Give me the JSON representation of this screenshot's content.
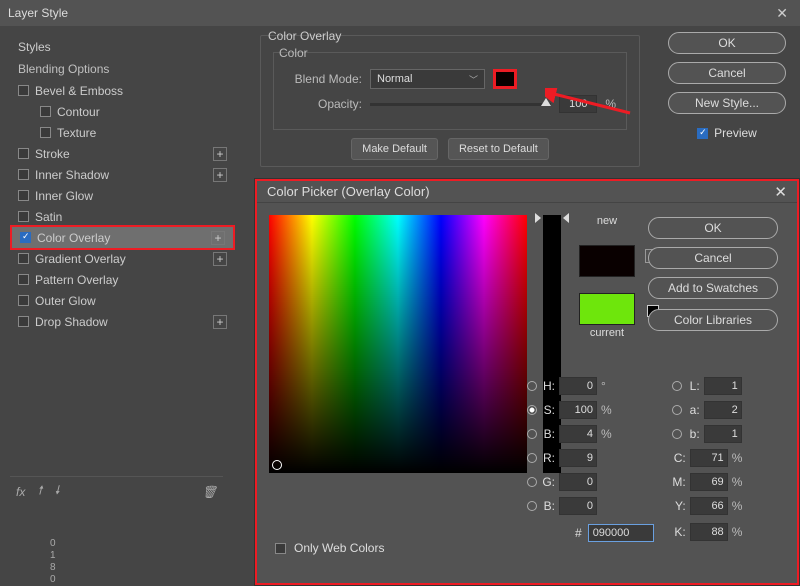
{
  "window": {
    "title": "Layer Style"
  },
  "sidebar": {
    "header": "Styles",
    "blending": "Blending Options",
    "items": [
      {
        "label": "Bevel & Emboss",
        "checked": false,
        "plus": false
      },
      {
        "label": "Contour",
        "checked": false,
        "plus": false,
        "indent": true
      },
      {
        "label": "Texture",
        "checked": false,
        "plus": false,
        "indent": true
      },
      {
        "label": "Stroke",
        "checked": false,
        "plus": true
      },
      {
        "label": "Inner Shadow",
        "checked": false,
        "plus": true
      },
      {
        "label": "Inner Glow",
        "checked": false,
        "plus": false
      },
      {
        "label": "Satin",
        "checked": false,
        "plus": false
      },
      {
        "label": "Color Overlay",
        "checked": true,
        "plus": true,
        "highlighted": true
      },
      {
        "label": "Gradient Overlay",
        "checked": false,
        "plus": true
      },
      {
        "label": "Pattern Overlay",
        "checked": false,
        "plus": false
      },
      {
        "label": "Outer Glow",
        "checked": false,
        "plus": false
      },
      {
        "label": "Drop Shadow",
        "checked": false,
        "plus": true
      }
    ],
    "fx_label": "fx"
  },
  "overlay": {
    "section_title": "Color Overlay",
    "color_label": "Color",
    "blend_mode_label": "Blend Mode:",
    "blend_mode_value": "Normal",
    "opacity_label": "Opacity:",
    "opacity_value": "100",
    "opacity_unit": "%",
    "make_default": "Make Default",
    "reset_default": "Reset to Default",
    "swatch_color": "#090000"
  },
  "buttons": {
    "ok": "OK",
    "cancel": "Cancel",
    "new_style": "New Style...",
    "preview": "Preview"
  },
  "picker": {
    "title": "Color Picker (Overlay Color)",
    "new_label": "new",
    "current_label": "current",
    "new_color": "#090000",
    "current_color": "#6ee60c",
    "ok": "OK",
    "cancel": "Cancel",
    "add_swatches": "Add to Swatches",
    "libraries": "Color Libraries",
    "only_web": "Only Web Colors",
    "fields": {
      "H": "0",
      "H_unit": "°",
      "S": "100",
      "S_unit": "%",
      "B": "4",
      "B_unit": "%",
      "R": "9",
      "G": "0",
      "B2": "0",
      "L": "1",
      "a": "2",
      "b_lab": "1",
      "C": "71",
      "C_unit": "%",
      "M": "69",
      "M_unit": "%",
      "Y": "66",
      "Y_unit": "%",
      "K": "88",
      "K_unit": "%",
      "hex": "090000"
    }
  },
  "ruler": [
    "0",
    "1",
    "8",
    "0"
  ]
}
